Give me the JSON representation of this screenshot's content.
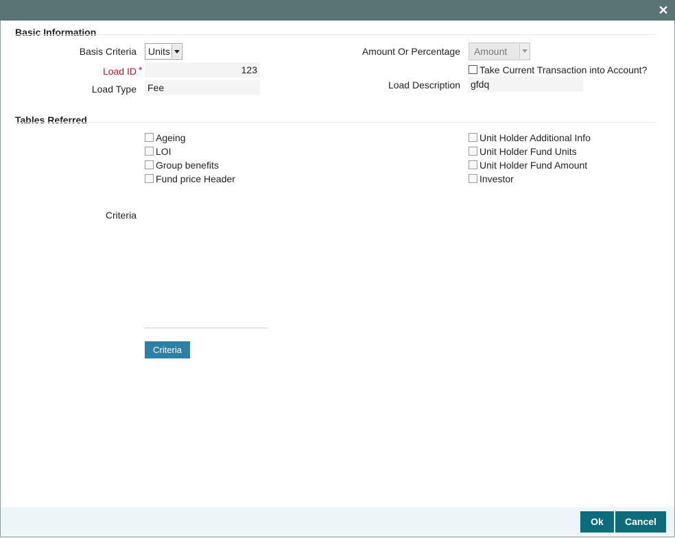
{
  "window": {
    "close_glyph": "✕"
  },
  "basic_information": {
    "title": "Basic Information",
    "basis_criteria": {
      "label": "Basis Criteria",
      "value": "Units"
    },
    "load_id": {
      "label": "Load ID",
      "required_mark": "*",
      "value": "123"
    },
    "load_type": {
      "label": "Load Type",
      "value": "Fee"
    },
    "amount_or_percentage": {
      "label": "Amount Or Percentage",
      "value": "Amount"
    },
    "take_current_transaction": {
      "label": "Take Current Transaction into Account?",
      "checked": false
    },
    "load_description": {
      "label": "Load Description",
      "value": "gfdq"
    }
  },
  "tables_referred": {
    "title": "Tables Referred",
    "left": [
      {
        "label": "Ageing",
        "checked": false
      },
      {
        "label": "LOI",
        "checked": false
      },
      {
        "label": "Group benefits",
        "checked": false
      },
      {
        "label": "Fund price Header",
        "checked": false
      }
    ],
    "right": [
      {
        "label": "Unit Holder Additional Info",
        "checked": false
      },
      {
        "label": "Unit Holder Fund Units",
        "checked": false
      },
      {
        "label": "Unit Holder Fund Amount",
        "checked": false
      },
      {
        "label": "Investor",
        "checked": false
      }
    ]
  },
  "criteria": {
    "label": "Criteria",
    "button_label": "Criteria"
  },
  "footer": {
    "ok_label": "Ok",
    "cancel_label": "Cancel"
  },
  "colors": {
    "titlebar": "#5a7474",
    "footer_button": "#0d6c7c",
    "criteria_button": "#2e7fa5",
    "required": "#c8102e"
  }
}
